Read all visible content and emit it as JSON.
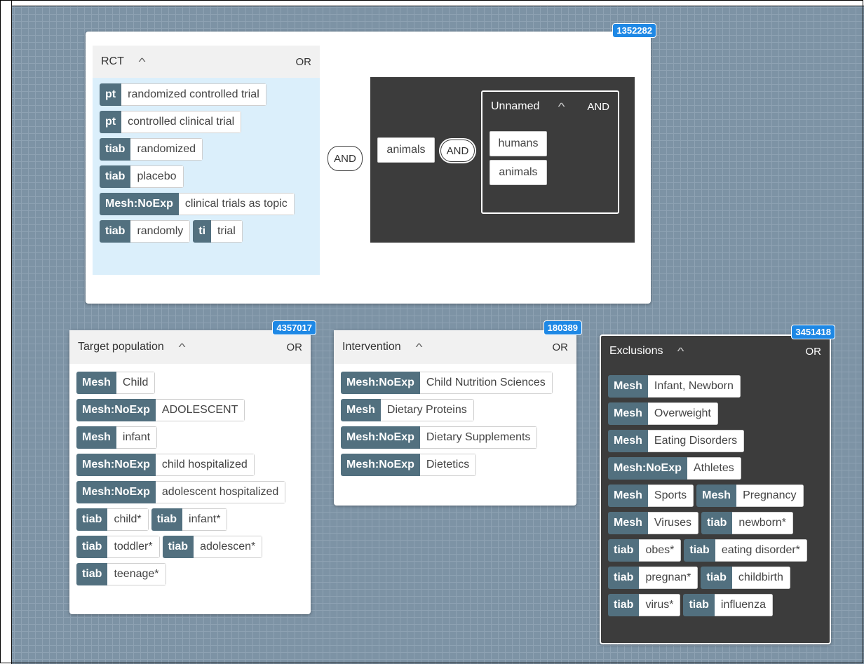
{
  "rct_card": {
    "count": "1352282",
    "rct_group": {
      "title": "RCT",
      "operator": "OR",
      "rows": [
        [
          {
            "tag": "pt",
            "value": "randomized controlled trial"
          }
        ],
        [
          {
            "tag": "pt",
            "value": "controlled clinical trial"
          }
        ],
        [
          {
            "tag": "tiab",
            "value": "randomized"
          }
        ],
        [
          {
            "tag": "tiab",
            "value": "placebo"
          }
        ],
        [
          {
            "tag": "Mesh:NoExp",
            "value": "clinical trials as topic"
          }
        ],
        [
          {
            "tag": "tiab",
            "value": "randomly"
          },
          {
            "tag": "ti",
            "value": "trial"
          }
        ]
      ]
    },
    "and_connector": "AND",
    "animals_group": {
      "animals_term": "animals",
      "and_connector": "AND",
      "unnamed": {
        "title": "Unnamed",
        "operator": "AND",
        "terms": [
          "humans",
          "animals"
        ]
      }
    }
  },
  "target_population": {
    "count": "4357017",
    "title": "Target population",
    "operator": "OR",
    "rows": [
      [
        {
          "tag": "Mesh",
          "value": "Child"
        }
      ],
      [
        {
          "tag": "Mesh:NoExp",
          "value": "ADOLESCENT"
        }
      ],
      [
        {
          "tag": "Mesh",
          "value": "infant"
        }
      ],
      [
        {
          "tag": "Mesh:NoExp",
          "value": "child hospitalized"
        }
      ],
      [
        {
          "tag": "Mesh:NoExp",
          "value": "adolescent hospitalized"
        }
      ],
      [
        {
          "tag": "tiab",
          "value": "child*"
        },
        {
          "tag": "tiab",
          "value": "infant*"
        }
      ],
      [
        {
          "tag": "tiab",
          "value": "toddler*"
        },
        {
          "tag": "tiab",
          "value": "adolescen*"
        }
      ],
      [
        {
          "tag": "tiab",
          "value": "teenage*"
        }
      ]
    ]
  },
  "intervention": {
    "count": "180389",
    "title": "Intervention",
    "operator": "OR",
    "rows": [
      [
        {
          "tag": "Mesh:NoExp",
          "value": "Child Nutrition Sciences"
        }
      ],
      [
        {
          "tag": "Mesh",
          "value": "Dietary Proteins"
        }
      ],
      [
        {
          "tag": "Mesh:NoExp",
          "value": "Dietary Supplements"
        }
      ],
      [
        {
          "tag": "Mesh:NoExp",
          "value": "Dietetics"
        }
      ]
    ]
  },
  "exclusions": {
    "count": "3451418",
    "title": "Exclusions",
    "operator": "OR",
    "rows": [
      [
        {
          "tag": "Mesh",
          "value": "Infant, Newborn"
        }
      ],
      [
        {
          "tag": "Mesh",
          "value": "Overweight"
        }
      ],
      [
        {
          "tag": "Mesh",
          "value": "Eating Disorders"
        }
      ],
      [
        {
          "tag": "Mesh:NoExp",
          "value": "Athletes"
        }
      ],
      [
        {
          "tag": "Mesh",
          "value": "Sports"
        },
        {
          "tag": "Mesh",
          "value": "Pregnancy"
        }
      ],
      [
        {
          "tag": "Mesh",
          "value": "Viruses"
        },
        {
          "tag": "tiab",
          "value": "newborn*"
        }
      ],
      [
        {
          "tag": "tiab",
          "value": "obes*"
        },
        {
          "tag": "tiab",
          "value": "eating disorder*"
        }
      ],
      [
        {
          "tag": "tiab",
          "value": "pregnan*"
        },
        {
          "tag": "tiab",
          "value": "childbirth"
        }
      ],
      [
        {
          "tag": "tiab",
          "value": "virus*"
        },
        {
          "tag": "tiab",
          "value": "influenza"
        }
      ]
    ]
  },
  "icons": {
    "collapse": "chevron-up-icon"
  },
  "colors": {
    "canvas": "#7d93a5",
    "badge": "#1e88e5",
    "tag": "#52707f",
    "rct_group_bg": "#dbeffb",
    "dark_group_bg": "#3c3c3c"
  }
}
